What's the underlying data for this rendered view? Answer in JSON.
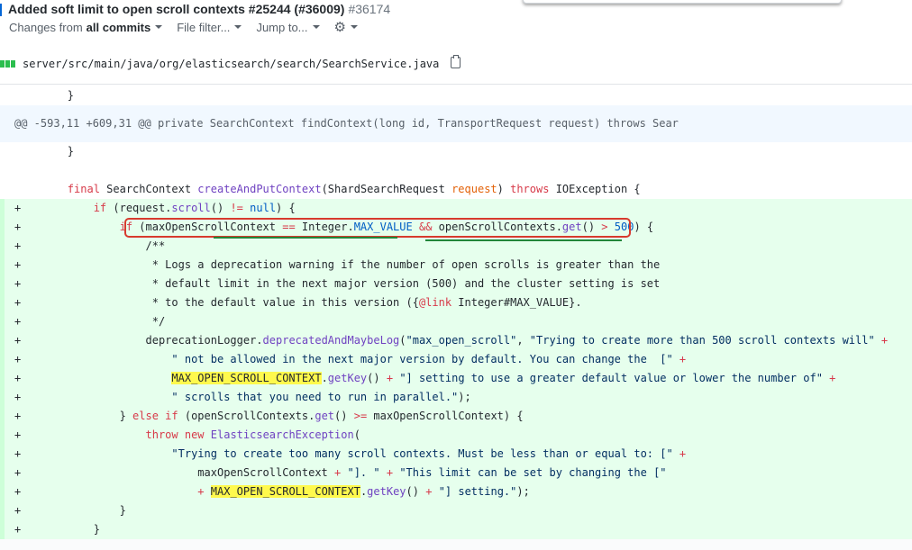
{
  "pr": {
    "title": "Added soft limit to open scroll contexts #25244 (#36009)",
    "number": "#36174"
  },
  "toolbar": {
    "changes_prefix": "Changes from",
    "changes_value": "all commits",
    "file_filter": "File filter...",
    "jump_to": "Jump to..."
  },
  "file": {
    "path": "server/src/main/java/org/elasticsearch/search/SearchService.java"
  },
  "diff": {
    "hunk_header": "@@ -593,11 +609,31 @@ private SearchContext findContext(long id, TransportRequest request) throws Sear",
    "add_marker": "+",
    "lines": [
      "}",
      "}",
      "",
      "final SearchContext createAndPutContext(ShardSearchRequest request) throws IOException {",
      "if (request.scroll() != null) {",
      "if (maxOpenScrollContext == Integer.MAX_VALUE && openScrollContexts.get() > 500) {",
      "/**",
      " * Logs a deprecation warning if the number of open scrolls is greater than the",
      " * default limit in the next major version (500) and the cluster setting is set",
      " * to the default value in this version ({@link Integer#MAX_VALUE}.",
      " */",
      "deprecationLogger.deprecatedAndMaybeLog(\"max_open_scroll\", \"Trying to create more than 500 scroll contexts will\" +",
      "\" not be allowed in the next major version by default. You can change the  [\" +",
      "MAX_OPEN_SCROLL_CONTEXT.getKey() + \"] setting to use a greater default value or lower the number of\" +",
      "\" scrolls that you need to run in parallel.\");",
      "} else if (openScrollContexts.get() >= maxOpenScrollContext) {",
      "throw new ElasticsearchException(",
      "\"Trying to create too many scroll contexts. Must be less than or equal to: [\" +",
      "maxOpenScrollContext + \"]. \" + \"This limit can be set by changing the [\"",
      "+ MAX_OPEN_SCROLL_CONTEXT.getKey() + \"] setting.\");",
      "}",
      "}"
    ]
  },
  "colors": {
    "add_bg": "#e6ffed",
    "hunk_bg": "#f1f8ff",
    "keyword": "#d73a49",
    "annotation_box": "#d73a2e",
    "highlight": "#fff94d"
  }
}
